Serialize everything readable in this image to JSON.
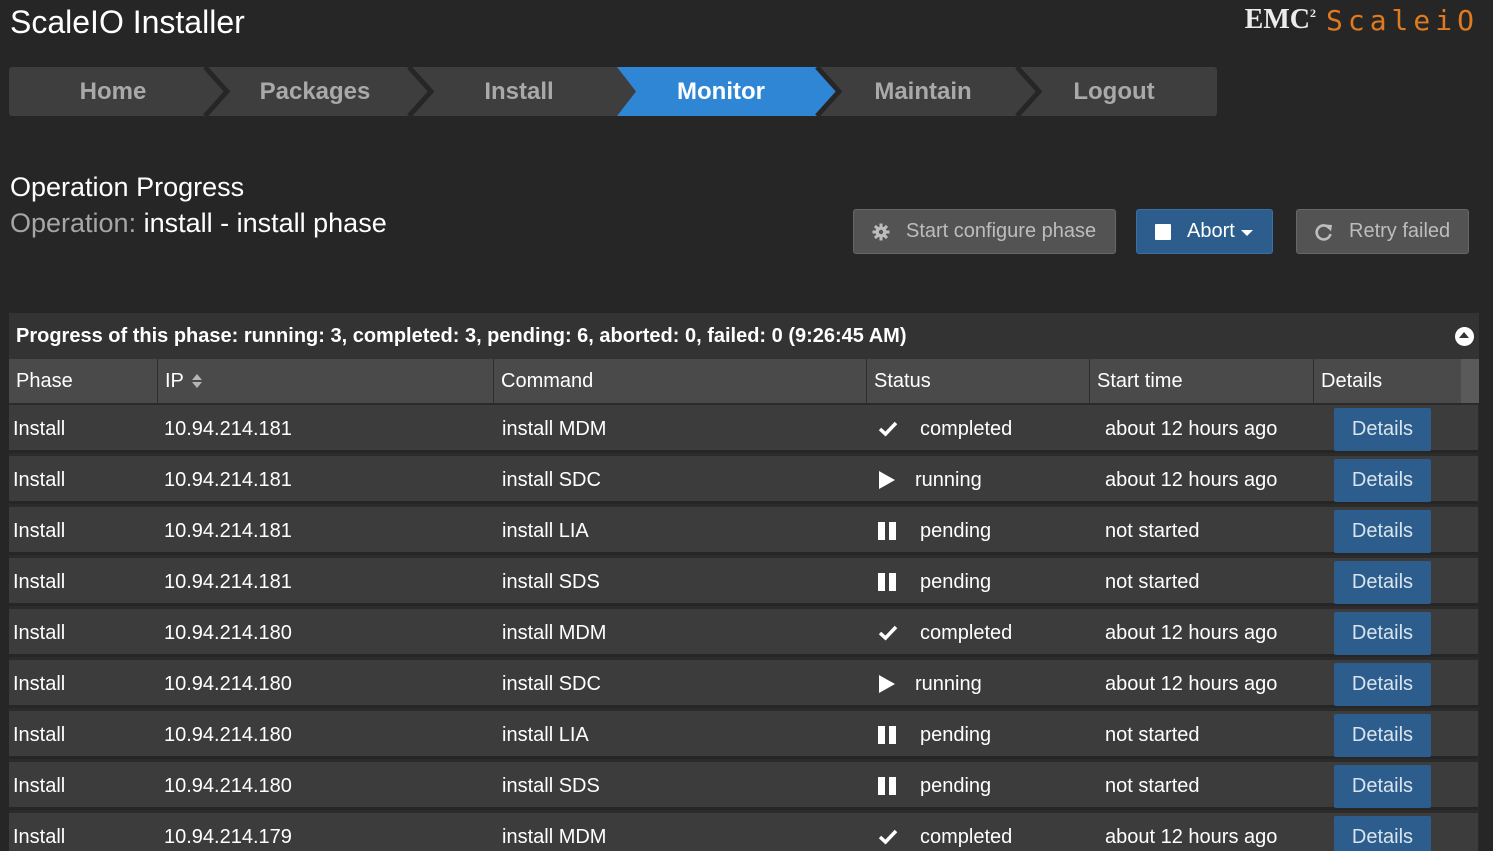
{
  "app": {
    "title": "ScaleIO Installer"
  },
  "brand": {
    "emc": "EMC",
    "superscript": "2",
    "product": "ScaleiO"
  },
  "nav": {
    "tabs": [
      {
        "label": "Home"
      },
      {
        "label": "Packages"
      },
      {
        "label": "Install"
      },
      {
        "label": "Monitor",
        "active": true
      },
      {
        "label": "Maintain"
      },
      {
        "label": "Logout"
      }
    ],
    "active_color": "#2f86d4"
  },
  "operation": {
    "heading": "Operation Progress",
    "label": "Operation:",
    "value": "install - install phase"
  },
  "actions": {
    "configure": {
      "label": "Start configure phase",
      "icon": "gear-icon"
    },
    "abort": {
      "label": "Abort",
      "icon": "stop-square-icon"
    },
    "retry": {
      "label": "Retry failed",
      "icon": "refresh-icon"
    }
  },
  "panel": {
    "title": "Progress of this phase: running: 3, completed: 3, pending: 6, aborted: 0, failed: 0 (9:26:45 AM)"
  },
  "table": {
    "columns": [
      "Phase",
      "IP",
      "Command",
      "Status",
      "Start time",
      "Details"
    ],
    "details_label": "Details",
    "rows": [
      {
        "phase": "Install",
        "ip": "10.94.214.181",
        "command": "install MDM",
        "status": "completed",
        "status_icon": "check-icon",
        "start": "about 12 hours ago"
      },
      {
        "phase": "Install",
        "ip": "10.94.214.181",
        "command": "install SDC",
        "status": "running",
        "status_icon": "play-icon",
        "start": "about 12 hours ago"
      },
      {
        "phase": "Install",
        "ip": "10.94.214.181",
        "command": "install LIA",
        "status": "pending",
        "status_icon": "pause-icon",
        "start": "not started"
      },
      {
        "phase": "Install",
        "ip": "10.94.214.181",
        "command": "install SDS",
        "status": "pending",
        "status_icon": "pause-icon",
        "start": "not started"
      },
      {
        "phase": "Install",
        "ip": "10.94.214.180",
        "command": "install MDM",
        "status": "completed",
        "status_icon": "check-icon",
        "start": "about 12 hours ago"
      },
      {
        "phase": "Install",
        "ip": "10.94.214.180",
        "command": "install SDC",
        "status": "running",
        "status_icon": "play-icon",
        "start": "about 12 hours ago"
      },
      {
        "phase": "Install",
        "ip": "10.94.214.180",
        "command": "install LIA",
        "status": "pending",
        "status_icon": "pause-icon",
        "start": "not started"
      },
      {
        "phase": "Install",
        "ip": "10.94.214.180",
        "command": "install SDS",
        "status": "pending",
        "status_icon": "pause-icon",
        "start": "not started"
      },
      {
        "phase": "Install",
        "ip": "10.94.214.179",
        "command": "install MDM",
        "status": "completed",
        "status_icon": "check-icon",
        "start": "about 12 hours ago"
      }
    ]
  }
}
